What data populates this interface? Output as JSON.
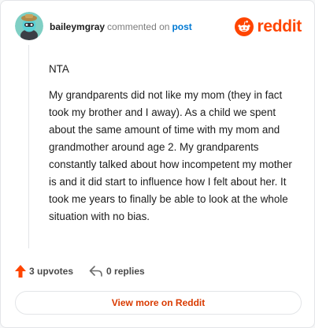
{
  "comment": {
    "username": "baileymgray",
    "action_text": "commented on",
    "target_link": "post",
    "paragraphs": [
      "NTA",
      "My grandparents did not like my mom (they in fact took my brother and I away). As a child we spent about the same amount of time with my mom and grandmother around age 2. My grandparents constantly talked about how incompetent my mother is and it did start to influence how I felt about her. It took me years to finally be able to look at the whole situation with no bias."
    ]
  },
  "brand": {
    "name": "reddit",
    "icon": "reddit-snoo-icon",
    "color": "#ff4500"
  },
  "actions": {
    "upvotes_label": "3 upvotes",
    "replies_label": "0 replies"
  },
  "footer": {
    "view_more_label": "View more on Reddit"
  },
  "colors": {
    "accent": "#ff4500",
    "link": "#0079d3",
    "button_text": "#d93a00"
  }
}
